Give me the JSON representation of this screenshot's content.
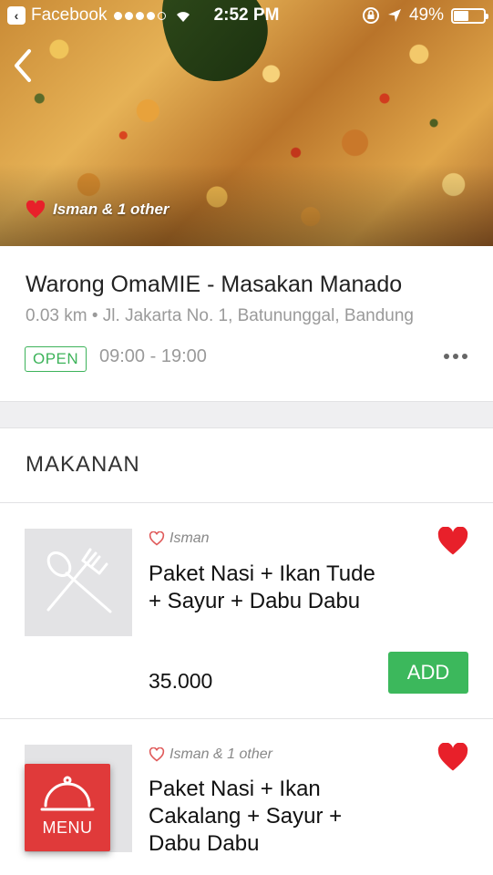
{
  "status_bar": {
    "back_app": "Facebook",
    "time": "2:52 PM",
    "battery": "49%",
    "battery_level": 0.49
  },
  "hero": {
    "likes_text": "Isman & 1 other"
  },
  "restaurant": {
    "name": "Warong OmaMIE - Masakan Manado",
    "address": "0.03 km • Jl. Jakarta No. 1, Batununggal, Bandung",
    "status": "OPEN",
    "hours": "09:00 - 19:00"
  },
  "section": {
    "title": "MAKANAN"
  },
  "items": [
    {
      "liker": "Isman",
      "name_line1": "Paket Nasi + Ikan Tude",
      "name_line2": "+ Sayur + Dabu Dabu",
      "name_line3": "",
      "price": "35.000",
      "add_label": "ADD",
      "liked": true
    },
    {
      "liker": "Isman & 1 other",
      "name_line1": "Paket Nasi + Ikan",
      "name_line2": "Cakalang + Sayur +",
      "name_line3": "Dabu Dabu",
      "liked": true
    }
  ],
  "fab": {
    "label": "MENU"
  },
  "colors": {
    "accent_green": "#3cb85c",
    "heart_red": "#e8202a",
    "menu_red": "#e03a3a"
  },
  "icons": {
    "back": "chevron-left-icon",
    "heart": "heart-icon",
    "utensils": "fork-spoon-icon",
    "cloche": "cloche-icon",
    "more": "more-dots-icon"
  }
}
